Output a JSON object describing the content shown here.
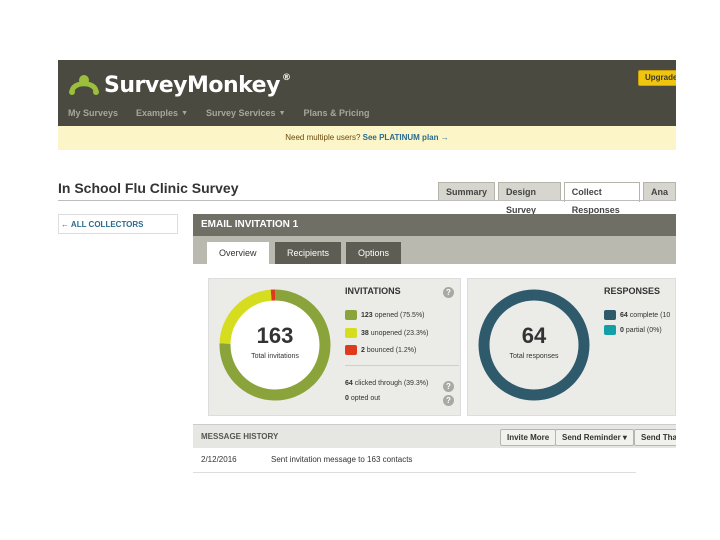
{
  "header": {
    "logo_text": "SurveyMonkey",
    "logo_reg": "®",
    "upgrade_label": "Upgrade",
    "nav": [
      {
        "label": "My Surveys",
        "caret": ""
      },
      {
        "label": "Examples",
        "caret": "▼"
      },
      {
        "label": "Survey Services",
        "caret": "▼"
      },
      {
        "label": "Plans & Pricing",
        "caret": ""
      }
    ]
  },
  "promo": {
    "text": "Need multiple users?",
    "link": "See PLATINUM plan →"
  },
  "survey": {
    "title": "In School Flu Clinic Survey",
    "tabs": [
      "Summary",
      "Design Survey",
      "Collect Responses",
      "Ana"
    ]
  },
  "left": {
    "all_collectors": "← ALL COLLECTORS"
  },
  "panel": {
    "header": "EMAIL INVITATION 1",
    "subtabs": [
      "Overview",
      "Recipients",
      "Options"
    ]
  },
  "invitations": {
    "title": "INVITATIONS",
    "total": "163",
    "total_label": "Total invitations",
    "legend": [
      {
        "count": "123",
        "text": "opened (75.5%)",
        "color": "#8aa33a",
        "value": 123
      },
      {
        "count": "38",
        "text": "unopened (23.3%)",
        "color": "#d6dc1e",
        "value": 38
      },
      {
        "count": "2",
        "text": "bounced (1.2%)",
        "color": "#e03a1e",
        "value": 2
      }
    ],
    "clicked": {
      "count": "64",
      "text": "clicked through (39.3%)"
    },
    "opted": {
      "count": "0",
      "text": "opted out"
    },
    "help": "?"
  },
  "responses": {
    "title": "RESPONSES",
    "total": "64",
    "total_label": "Total responses",
    "legend": [
      {
        "count": "64",
        "text": "complete (10",
        "color": "#2f5a6c",
        "value": 64
      },
      {
        "count": "0",
        "text": "partial (0%)",
        "color": "#129fa6",
        "value": 0
      }
    ]
  },
  "history": {
    "title": "MESSAGE HISTORY",
    "buttons": [
      "Invite More",
      "Send Reminder ▾",
      "Send Thar"
    ],
    "rows": [
      {
        "date": "2/12/2016",
        "message": "Sent invitation message to 163 contacts"
      }
    ]
  }
}
